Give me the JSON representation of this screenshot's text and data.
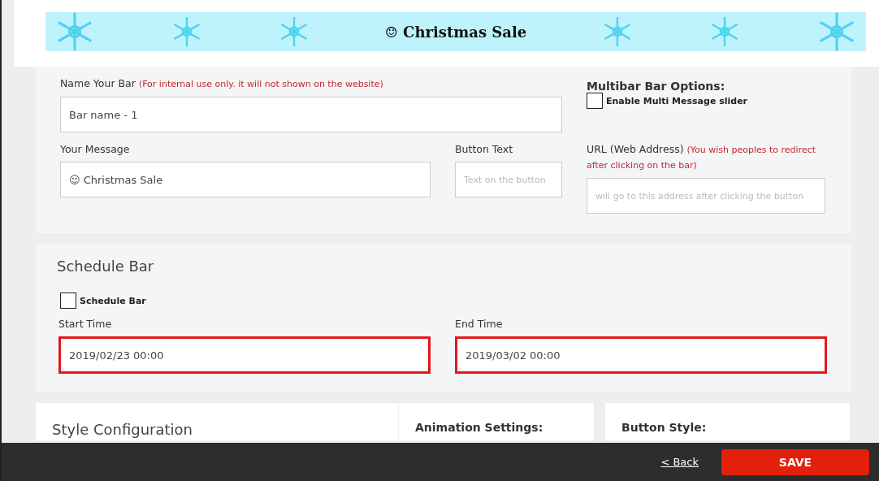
{
  "banner": {
    "text": "☺ Christmas Sale"
  },
  "bar_settings": {
    "name_label": "Name Your Bar",
    "name_note": "(For internal use only. it will not shown on the website)",
    "name_value": "Bar name - 1",
    "message_label": "Your Message",
    "message_value": "☺ Christmas Sale",
    "button_text_label": "Button Text",
    "button_text_placeholder": "Text on the button",
    "multibar_title": "Multibar Bar Options:",
    "multibar_option": {
      "label": "Enable Multi Message slider",
      "checked": false
    },
    "url_label": "URL (Web Address)",
    "url_note": "(You wish peoples to redirect after clicking on the bar)",
    "url_placeholder": "will go to this address after clicking the button"
  },
  "schedule": {
    "title": "Schedule Bar",
    "toggle": {
      "label": "Schedule Bar",
      "checked": false
    },
    "fields": [
      {
        "label": "Start Time",
        "value": "2019/02/23 00:00",
        "highlighted": true
      },
      {
        "label": "End Time",
        "value": "2019/03/02 00:00",
        "highlighted": true
      }
    ]
  },
  "style_config": {
    "title": "Style Configuration"
  },
  "animation": {
    "title": "Animation Settings:"
  },
  "button_style": {
    "title": "Button Style:"
  },
  "footer": {
    "back_link": "< Back",
    "save_button": "SAVE"
  }
}
